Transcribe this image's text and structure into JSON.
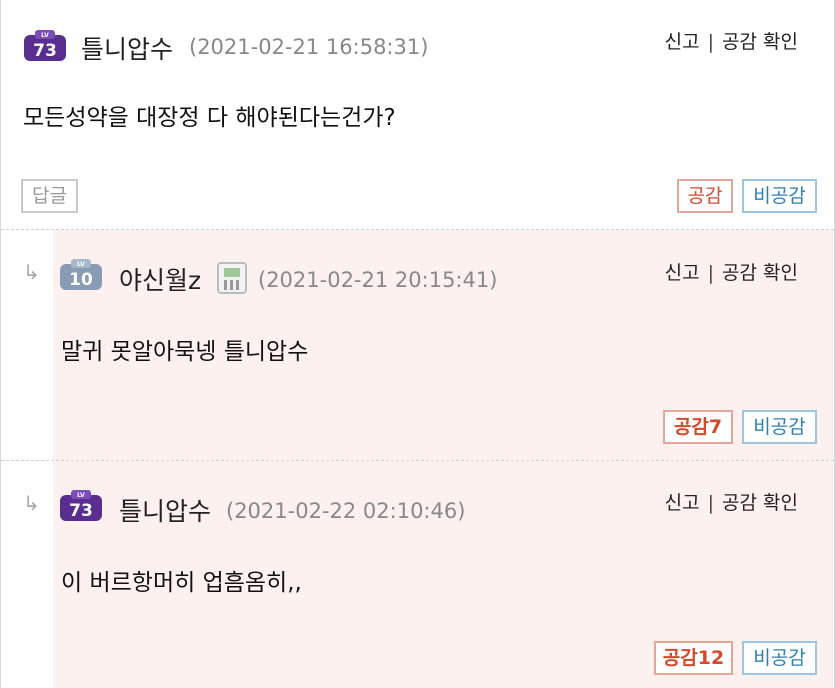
{
  "comments": [
    {
      "level": "73",
      "nickname": "틀니압수",
      "date": "(2021-02-21 16:58:31)",
      "report": "신고",
      "sep": "|",
      "like_check": "공감 확인",
      "text": "모든성약을 대장정 다 해야된다는건가?",
      "reply_label": "답글",
      "like_label": "공감",
      "dislike_label": "비공감"
    },
    {
      "level": "10",
      "nickname": "야신월z",
      "date": "(2021-02-21 20:15:41)",
      "report": "신고",
      "sep": "|",
      "like_check": "공감 확인",
      "text": "말귀 못알아묵넹 틀니압수",
      "like_label": "공감7",
      "dislike_label": "비공감"
    },
    {
      "level": "73",
      "nickname": "틀니압수",
      "date": "(2021-02-22 02:10:46)",
      "report": "신고",
      "sep": "|",
      "like_check": "공감 확인",
      "text": "이 버르항머히 업흠옴히,,",
      "like_label": "공감12",
      "dislike_label": "비공감"
    }
  ],
  "reply_arrow": "↳",
  "colors": {
    "level_purple": "#5a2d91",
    "level_gray": "#8a9bb5",
    "pink_bg": "#fdf1f0"
  }
}
